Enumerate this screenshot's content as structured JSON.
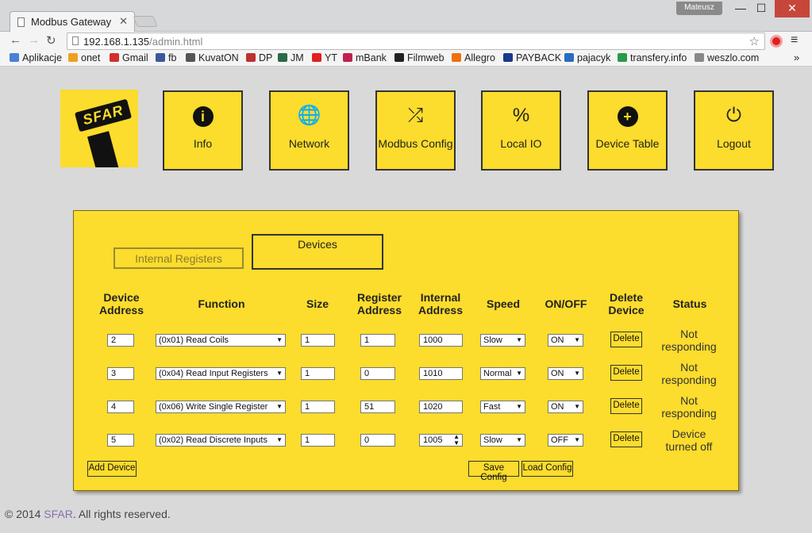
{
  "browser": {
    "tab_title": "Modbus Gateway",
    "tab_close": "✕",
    "user": "Mateusz",
    "url_host": "192.168.1.135",
    "url_path": "/admin.html",
    "window": {
      "minimize": "—",
      "maximize": "☐",
      "close": "✕"
    },
    "nav": {
      "back": "←",
      "forward": "→",
      "reload": "↻"
    },
    "bookmarks": [
      {
        "label": "Aplikacje",
        "color": "#4a7fd8"
      },
      {
        "label": "onet",
        "color": "#f0a020"
      },
      {
        "label": "Gmail",
        "color": "#d03030"
      },
      {
        "label": "fb",
        "color": "#3b5998"
      },
      {
        "label": "KuvatON",
        "color": "#555555"
      },
      {
        "label": "DP",
        "color": "#c03030"
      },
      {
        "label": "JM",
        "color": "#2a6a4a"
      },
      {
        "label": "YT",
        "color": "#e02020"
      },
      {
        "label": "mBank",
        "color": "#c02050"
      },
      {
        "label": "Filmweb",
        "color": "#222222"
      },
      {
        "label": "Allegro",
        "color": "#f07010"
      },
      {
        "label": "PAYBACK",
        "color": "#1a3a8a"
      },
      {
        "label": "pajacyk",
        "color": "#2a6ac0"
      },
      {
        "label": "transfery.info",
        "color": "#2a9a4a"
      },
      {
        "label": "weszlo.com",
        "color": "#888888"
      }
    ],
    "bookmarks_more": "»"
  },
  "nav_tiles": [
    {
      "label": "Info",
      "icon": "info-icon",
      "glyph": "i"
    },
    {
      "label": "Network",
      "icon": "globe-icon",
      "glyph": "🌐"
    },
    {
      "label": "Modbus Config",
      "icon": "shuffle-icon",
      "glyph": "⤮"
    },
    {
      "label": "Local IO",
      "icon": "percent-icon",
      "glyph": "%"
    },
    {
      "label": "Device Table",
      "icon": "plus-circle-icon",
      "glyph": "+"
    },
    {
      "label": "Logout",
      "icon": "power-icon",
      "glyph": "⏻"
    }
  ],
  "logo_text": "SFAR",
  "tabs": {
    "internal": "Internal Registers",
    "devices": "Devices"
  },
  "headers": {
    "device_address": "Device Address",
    "function": "Function",
    "size": "Size",
    "register_address": "Register Address",
    "internal_address": "Internal Address",
    "speed": "Speed",
    "onoff": "ON/OFF",
    "delete_device": "Delete Device",
    "status": "Status"
  },
  "rows": [
    {
      "device_address": "2",
      "function": "(0x01) Read Coils",
      "size": "1",
      "register_address": "1",
      "internal_address": "1000",
      "speed": "Slow",
      "onoff": "ON",
      "delete": "Delete",
      "status": "Not responding"
    },
    {
      "device_address": "3",
      "function": "(0x04) Read Input Registers",
      "size": "1",
      "register_address": "0",
      "internal_address": "1010",
      "speed": "Normal",
      "onoff": "ON",
      "delete": "Delete",
      "status": "Not responding"
    },
    {
      "device_address": "4",
      "function": "(0x06) Write Single Register",
      "size": "1",
      "register_address": "51",
      "internal_address": "1020",
      "speed": "Fast",
      "onoff": "ON",
      "delete": "Delete",
      "status": "Not responding"
    },
    {
      "device_address": "5",
      "function": "(0x02) Read Discrete Inputs",
      "size": "1",
      "register_address": "0",
      "internal_address": "1005",
      "speed": "Slow",
      "onoff": "OFF",
      "delete": "Delete",
      "status": "Device turned off"
    }
  ],
  "buttons": {
    "add_device": "Add Device",
    "save_config": "Save Config",
    "load_config": "Load Config"
  },
  "footer": {
    "prefix": "© 2014 ",
    "brand": "SFAR",
    "suffix": ". All rights reserved."
  },
  "colors": {
    "accent": "#fcdc2c",
    "background": "#d9d9d9"
  }
}
